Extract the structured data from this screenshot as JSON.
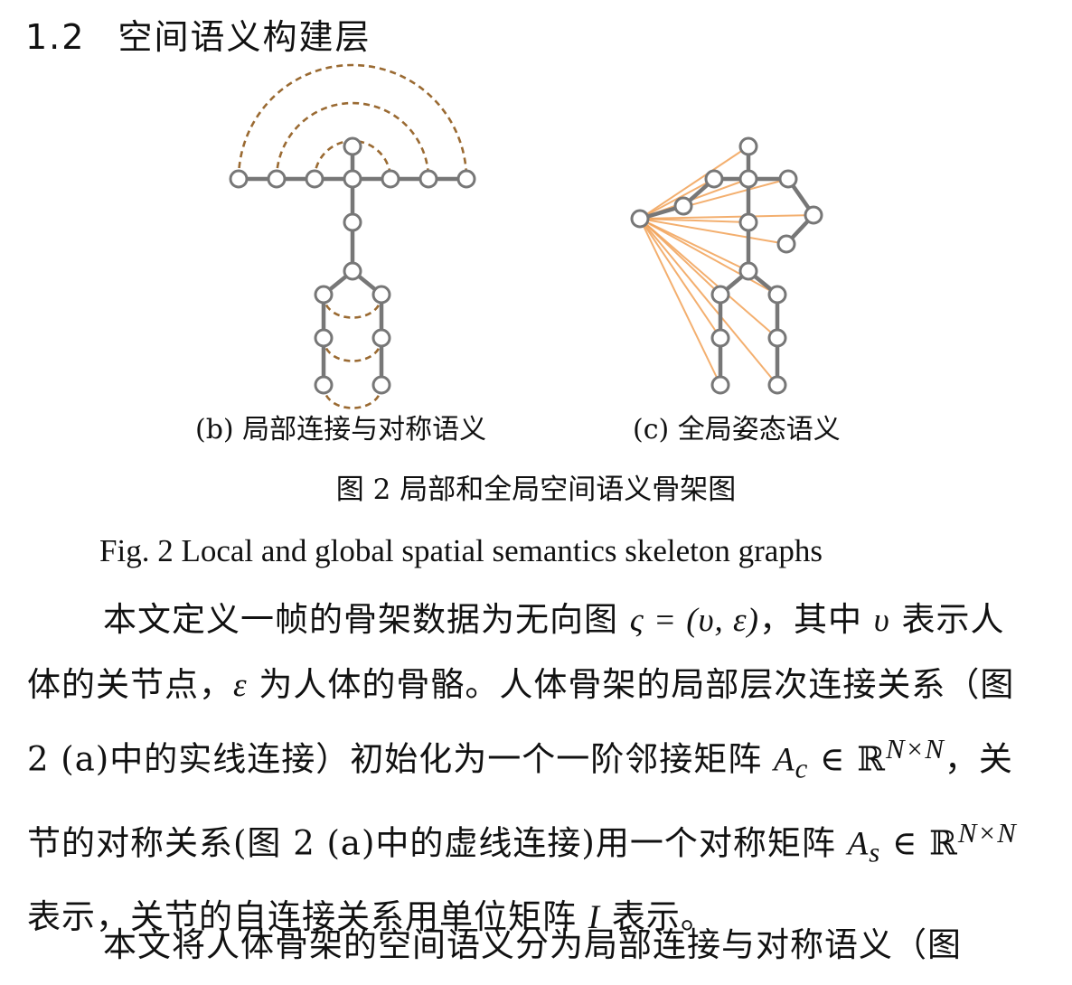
{
  "section": {
    "number": "1.2",
    "title": "空间语义构建层"
  },
  "figure": {
    "sub_b": "(b) 局部连接与对称语义",
    "sub_c": "(c) 全局姿态语义",
    "caption_cn": "图 2  局部和全局空间语义骨架图",
    "caption_en": "Fig. 2 Local and global spatial semantics skeleton graphs"
  },
  "p1": {
    "t1": "本文定义一帧的骨架数据为无向图 ",
    "m1": "ς = (υ, ε)",
    "t2": "，其中 ",
    "m2": "υ",
    "t3": " 表示人体的关节点，",
    "m3": "ε",
    "t4": " 为人体的骨骼。人体骨架的局部层次连接关系（图 2 (a)中的实线连接）初始化为一个一阶邻接矩阵 ",
    "m4": "A",
    "m4sub": "c",
    "m4rest": " ∈ ℝ",
    "m4sup": "N×N",
    "t5": "，关节的对称关系(图 2 (a)中的虚线连接)用一个对称矩阵 ",
    "m5": "A",
    "m5sub": "s",
    "m5rest": " ∈ ℝ",
    "m5sup": "N×N",
    "t6": " 表示，关节的自连接关系用单位矩阵 ",
    "m6": "I",
    "t7": " 表示。"
  },
  "p2": {
    "text": "本文将人体骨架的空间语义分为局部连接与对称语义（图"
  },
  "colors": {
    "bone": "#777777",
    "symmetry_arc": "#9a6a32",
    "global_ray": "#f2a257"
  }
}
